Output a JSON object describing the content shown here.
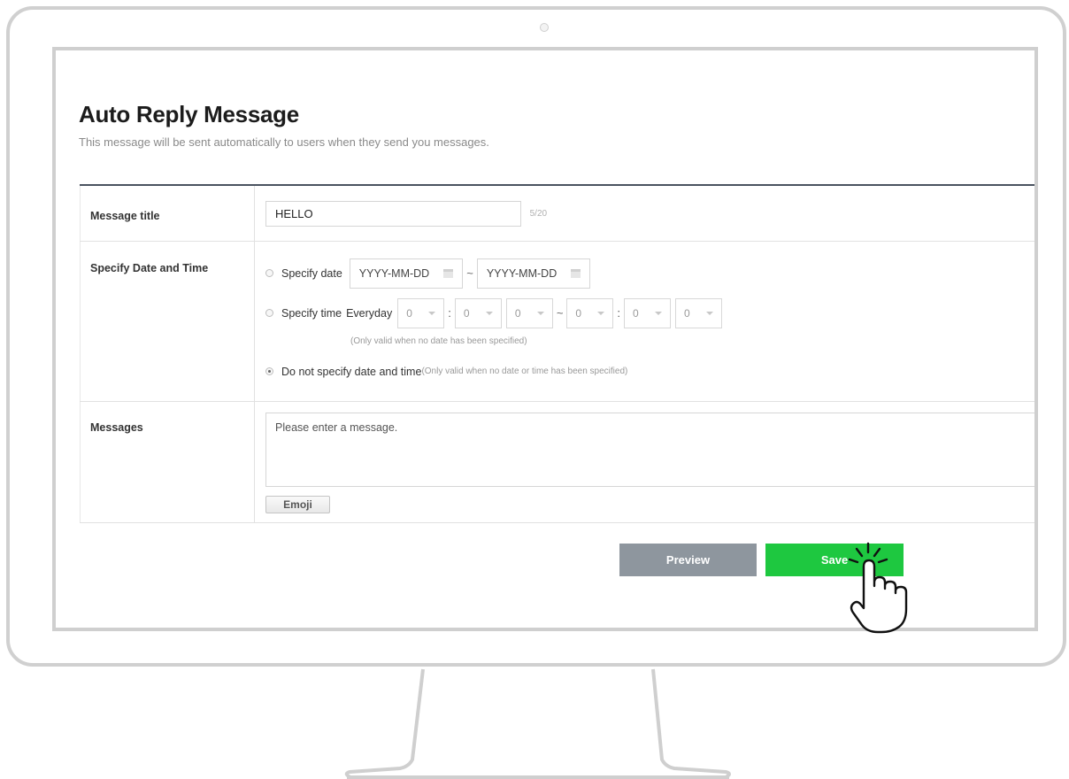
{
  "page": {
    "title": "Auto Reply Message",
    "subtitle": "This message will be sent automatically to users when they send you messages."
  },
  "form": {
    "title_row": {
      "label": "Message title",
      "value": "HELLO",
      "counter": "5/20"
    },
    "date_row": {
      "label": "Specify Date and Time",
      "specify_date": {
        "label": "Specify date",
        "start_placeholder": "YYYY-MM-DD",
        "separator": "~",
        "end_placeholder": "YYYY-MM-DD",
        "selected": false
      },
      "specify_time": {
        "label": "Specify time",
        "repeat": "Everyday",
        "start_hour": "0",
        "start_minute": "0",
        "start_second": "0",
        "separator": "~",
        "end_hour": "0",
        "end_minute": "0",
        "end_second": "0",
        "colon": ":",
        "note": "(Only valid when no date has been specified)",
        "selected": false
      },
      "no_date_time": {
        "label": "Do not specify date and time",
        "note": "(Only valid when no date or time has been specified)",
        "selected": true
      }
    },
    "message_row": {
      "label": "Messages",
      "placeholder": "Please enter a message.",
      "emoji_label": "Emoji"
    }
  },
  "actions": {
    "preview_label": "Preview",
    "save_label": "Save"
  },
  "colors": {
    "save": "#1ec840",
    "preview": "#8e969e",
    "table_border": "#4a5360",
    "bezel": "#d0d0d0"
  },
  "icons": {
    "calendar": "calendar-icon",
    "cursor": "hand-pointer-icon",
    "dropdown": "chevron-down-icon"
  }
}
